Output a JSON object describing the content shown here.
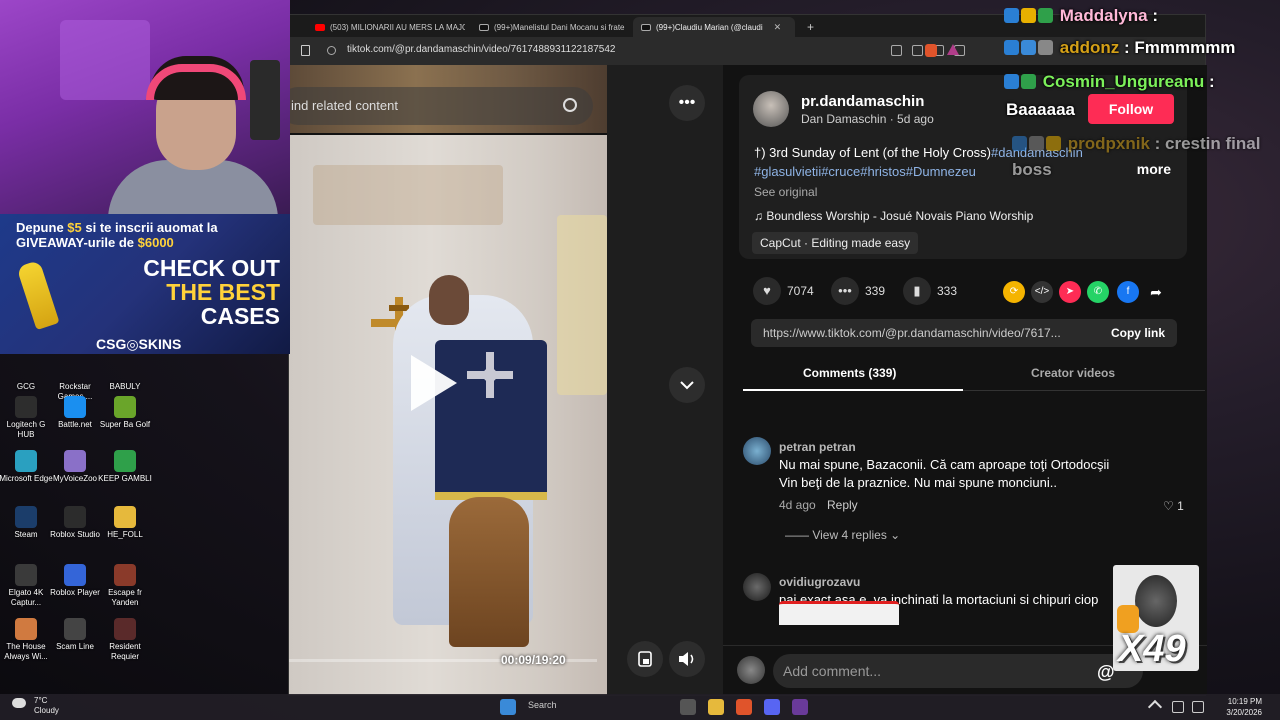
{
  "desktop_icons": [
    {
      "label": "GCG",
      "color": "#c03030"
    },
    {
      "label": "Rockstar Games ...",
      "color": "#f0a020"
    },
    {
      "label": "BABULY",
      "color": "#e03a3a"
    },
    {
      "label": "Logitech G HUB",
      "color": "#2d2d2d"
    },
    {
      "label": "Battle.net",
      "color": "#1a8ff0"
    },
    {
      "label": "Super Ba Golf",
      "color": "#6aa52a"
    },
    {
      "label": "Microsoft Edge",
      "color": "#2aa0c0"
    },
    {
      "label": "MyVoiceZoo",
      "color": "#8a70c8"
    },
    {
      "label": "KEEP GAMBLI",
      "color": "#2fa04a"
    },
    {
      "label": "Steam",
      "color": "#1b3d6a"
    },
    {
      "label": "Roblox Studio",
      "color": "#2c2c2c"
    },
    {
      "label": "HE_FOLL",
      "color": "#e6b93c"
    },
    {
      "label": "Elgato 4K Captur...",
      "color": "#3a3a3a"
    },
    {
      "label": "Roblox Player",
      "color": "#3465d8"
    },
    {
      "label": "Escape fr Yanden",
      "color": "#8a3a2a"
    },
    {
      "label": "The House Always Wi...",
      "color": "#d07a40"
    },
    {
      "label": "Scam Line",
      "color": "#444"
    },
    {
      "label": "Resident Requier",
      "color": "#5a2a2a"
    }
  ],
  "browser": {
    "tabs": [
      {
        "label": "(503) MILIONARII AU MERS LA MAJO",
        "fav_color": "#ff0000",
        "close": ""
      },
      {
        "label": "(99+)Manelistul Dani Mocanu si frate",
        "fav_color": "#111111",
        "close": ""
      },
      {
        "label": "(99+)Claudiu Marian (@claudi",
        "fav_color": "#111111",
        "close": "✕"
      }
    ],
    "new_tab": "+",
    "url": "tiktok.com/@pr.dandamaschin/video/7617488931122187542"
  },
  "video": {
    "search_placeholder": "ind related content",
    "timecode": "00:09/19:20",
    "progress_fraction": 0.008
  },
  "post": {
    "username": "pr.dandamaschin",
    "display_name": "Dan Damaschin",
    "age": "5d ago",
    "description": "†) 3rd Sunday of Lent (of the Holy Cross)",
    "hashtags": "#dandamaschin #glasulvietii#cruce#hristos#Dumnezeu",
    "more": "more",
    "see_original": "See original",
    "music": "♫  Boundless Worship - Josué Novais Piano Worship",
    "capcut": "CapCut · Editing made easy",
    "likes": "7074",
    "comments": "339",
    "saves": "333",
    "link": "https://www.tiktok.com/@pr.dandamaschin/video/7617...",
    "copy_link": "Copy link",
    "tab_comments": "Comments (339)",
    "tab_creator": "Creator videos"
  },
  "comments": [
    {
      "author": "petran petran",
      "text1": "Nu mai spune, Bazaconii. Că cam aproape toţi Ortodocşii",
      "text2": "Vin beţi de la praznice. Nu mai spune monciuni..",
      "age": "4d ago",
      "reply": "Reply",
      "likes": "1",
      "view_replies": "View 4 replies"
    },
    {
      "author": "ovidiugrozavu",
      "text1": "pai exact asa e. va inchinati la mortaciuni si chipuri ciop"
    }
  ],
  "add_comment_placeholder": "Add comment...",
  "at_symbol": "@",
  "overlay": {
    "promo_line1_a": "Depune",
    "promo_amount": "$5",
    "promo_line1_b": "si te inscrii auomat la",
    "promo_line2_a": "GIVEAWAY-urile de",
    "promo_prize": "$6000",
    "check_out": "CHECK OUT",
    "the_best": "THE BEST",
    "cases": "CASES",
    "brand": "CSG◎SKINS"
  },
  "chat": [
    {
      "user": "Maddalyna",
      "sep": " :",
      "msg": "",
      "color": "#ffb8d8"
    },
    {
      "user": "addonz",
      "sep": " :",
      "msg": " Fmmmmmm",
      "color": "#d4a017"
    },
    {
      "user": "Cosmin_Ungureanu",
      "sep": " :",
      "msg": "",
      "color": "#7cf05a"
    },
    {
      "user": "",
      "sep": "",
      "msg": "Baaaaaa",
      "color": "#ffffff"
    },
    {
      "user": "prodpxnik",
      "sep": " :",
      "msg": " crestin final",
      "color": "#d4a017"
    },
    {
      "user": "",
      "sep": "",
      "msg": "boss",
      "color": "#ffffff"
    }
  ],
  "follow_label": "Follow",
  "emote_count": "X49",
  "taskbar": {
    "temp": "7°C",
    "weather": "Cloudy",
    "search": "Search",
    "time": "10:19 PM",
    "date": "3/20/2026"
  }
}
